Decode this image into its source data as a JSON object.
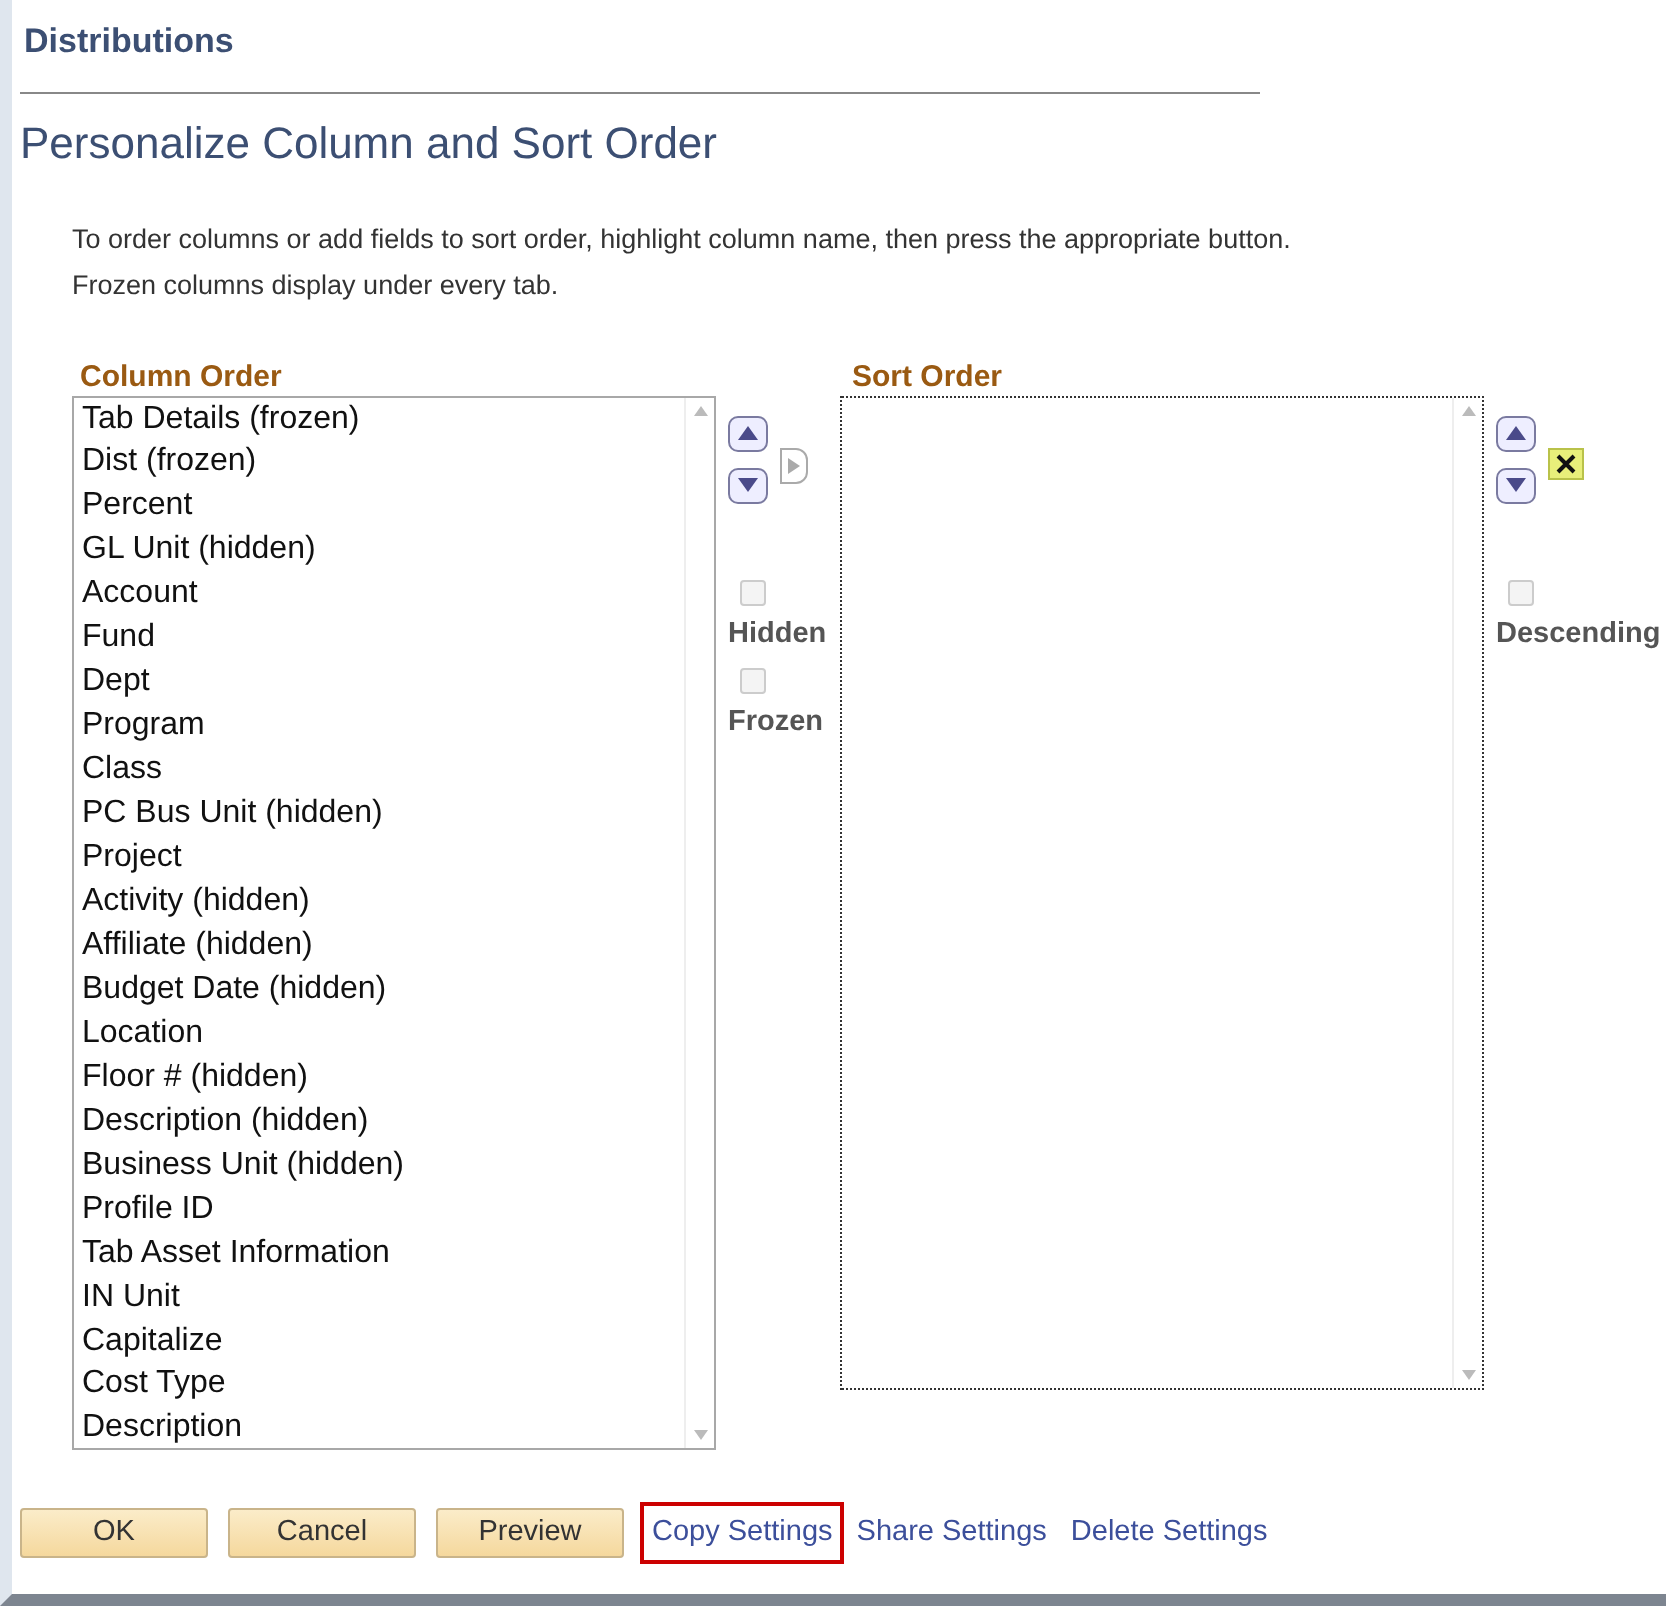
{
  "section_title": "Distributions",
  "page_title": "Personalize Column and Sort Order",
  "instructions": [
    "To order columns or add fields to sort order, highlight column name, then press the appropriate button.",
    "Frozen columns display under every tab."
  ],
  "column_order": {
    "label": "Column Order",
    "items": [
      {
        "text": "Tab Details (frozen)",
        "selected": false
      },
      {
        "text": "Dist (frozen)",
        "selected": false
      },
      {
        "text": "Percent",
        "selected": false
      },
      {
        "text": "GL Unit (hidden)",
        "selected": false
      },
      {
        "text": "Account",
        "selected": false
      },
      {
        "text": "Fund",
        "selected": false
      },
      {
        "text": "Dept",
        "selected": false
      },
      {
        "text": "Program",
        "selected": false
      },
      {
        "text": "Class",
        "selected": false
      },
      {
        "text": "PC Bus Unit (hidden)",
        "selected": false
      },
      {
        "text": "Project",
        "selected": false
      },
      {
        "text": "Activity (hidden)",
        "selected": false
      },
      {
        "text": "Affiliate (hidden)",
        "selected": false
      },
      {
        "text": "Budget Date (hidden)",
        "selected": false
      },
      {
        "text": "Location",
        "selected": false
      },
      {
        "text": "Floor # (hidden)",
        "selected": false
      },
      {
        "text": "Description (hidden)",
        "selected": false
      },
      {
        "text": "Business Unit (hidden)",
        "selected": false
      },
      {
        "text": "Profile ID",
        "selected": false
      },
      {
        "text": "Tab Asset Information",
        "selected": false
      },
      {
        "text": "IN Unit",
        "selected": false
      },
      {
        "text": "Capitalize",
        "selected": false
      },
      {
        "text": "Cost Type",
        "selected": false
      },
      {
        "text": "Description",
        "selected": false
      }
    ]
  },
  "column_options": [
    {
      "label": "Hidden",
      "checked": false,
      "disabled": true
    },
    {
      "label": "Frozen",
      "checked": false,
      "disabled": true
    }
  ],
  "sort_order": {
    "label": "Sort Order"
  },
  "sort_options": [
    {
      "label": "Descending",
      "checked": false,
      "disabled": true
    }
  ],
  "buttons": [
    "OK",
    "Cancel",
    "Preview"
  ],
  "links": [
    {
      "text": "Copy Settings",
      "highlighted": true
    },
    {
      "text": "Share Settings",
      "highlighted": false
    },
    {
      "text": "Delete Settings",
      "highlighted": false
    }
  ]
}
